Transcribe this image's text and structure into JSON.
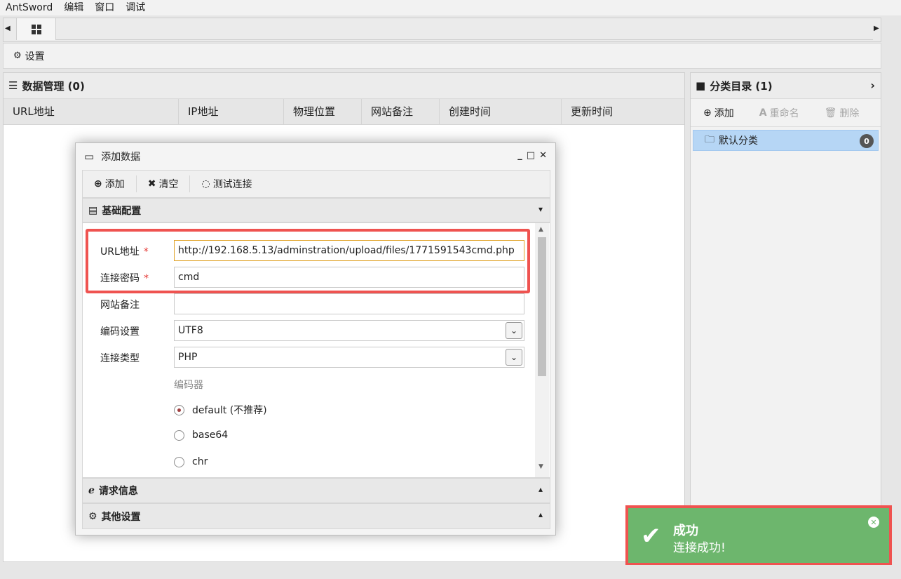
{
  "menu": {
    "app": "AntSword",
    "edit": "编辑",
    "window": "窗口",
    "debug": "调试"
  },
  "toolbar": {
    "settings_label": "设置"
  },
  "data_panel": {
    "title": "数据管理 (0)",
    "columns": [
      "URL地址",
      "IP地址",
      "物理位置",
      "网站备注",
      "创建时间",
      "更新时间"
    ]
  },
  "category_panel": {
    "title": "分类目录 (1)",
    "add_label": "添加",
    "rename_label": "重命名",
    "delete_label": "删除",
    "items": [
      {
        "label": "默认分类",
        "count": "0"
      }
    ]
  },
  "dialog": {
    "title": "添加数据",
    "add_label": "添加",
    "clear_label": "清空",
    "test_label": "测试连接",
    "section_basic": "基础配置",
    "section_request": "请求信息",
    "section_other": "其他设置",
    "fields": {
      "url_label": "URL地址",
      "url_value": "http://192.168.5.13/adminstration/upload/files/1771591543cmd.php",
      "password_label": "连接密码",
      "password_value": "cmd",
      "note_label": "网站备注",
      "note_value": "",
      "encoding_label": "编码设置",
      "encoding_value": "UTF8",
      "type_label": "连接类型",
      "type_value": "PHP",
      "encoder_label": "编码器",
      "encoders": [
        "default (不推荐)",
        "base64",
        "chr"
      ],
      "required_mark": "*"
    }
  },
  "toast": {
    "title": "成功",
    "message": "连接成功!"
  },
  "colors": {
    "toast_bg": "#6db66d",
    "highlight_border": "#ef5350",
    "selected_item": "#b6d6f5"
  }
}
